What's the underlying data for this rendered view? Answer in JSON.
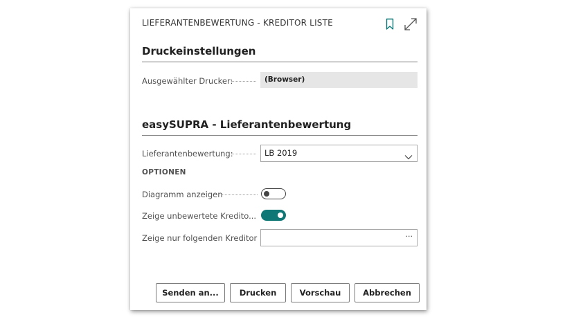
{
  "dialog": {
    "title": "LIEFERANTENBEWERTUNG - KREDITOR LISTE",
    "icons": {
      "bookmark": "bookmark-icon",
      "expand": "expand-icon"
    }
  },
  "print_settings": {
    "heading": "Druckeinstellungen",
    "printer_label": "Ausgewählter Drucker:",
    "printer_value": "(Browser)"
  },
  "easysupra": {
    "heading": "easySUPRA - Lieferantenbewertung",
    "rating_label": "Lieferantenbewertung:",
    "rating_value": "LB 2019",
    "options_label": "OPTIONEN",
    "show_chart_label": "Diagramm anzeigen",
    "show_chart": false,
    "show_unrated_label": "Zeige unbewertete Kredito...",
    "show_unrated": true,
    "only_creditor_label": "Zeige nur folgenden Kreditor",
    "only_creditor_value": "",
    "lookup_more": "···"
  },
  "buttons": {
    "send": "Senden an...",
    "print": "Drucken",
    "preview": "Vorschau",
    "cancel": "Abbrechen"
  },
  "colors": {
    "toggle_on": "#0f7776",
    "field_bg": "#e6e6e6"
  }
}
